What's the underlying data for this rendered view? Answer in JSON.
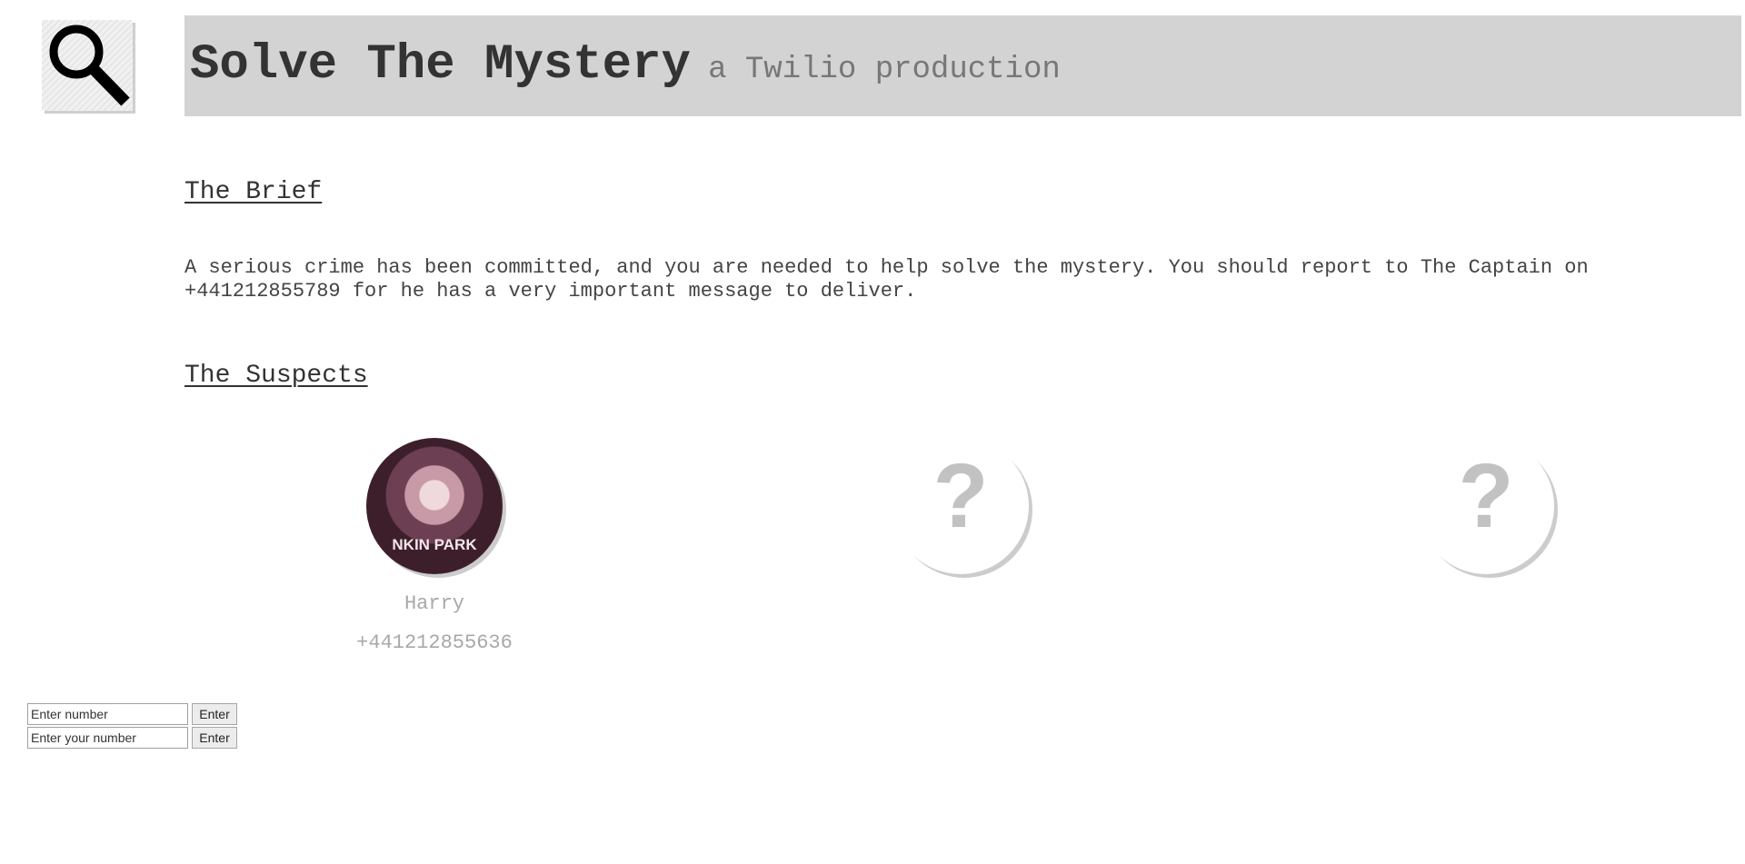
{
  "header": {
    "title": "Solve The Mystery",
    "subtitle": "a Twilio production",
    "logo_icon": "magnifying-glass-icon"
  },
  "brief": {
    "heading": "The Brief",
    "text": "A serious crime has been committed, and you are needed to help solve the mystery. You should report to The Captain on +441212855789 for he has a very important message to deliver."
  },
  "suspects": {
    "heading": "The Suspects",
    "items": [
      {
        "name": "Harry",
        "number": "+441212855636",
        "shirt_text": "NKIN PARK",
        "avatar": "photo"
      },
      {
        "name": "",
        "number": "",
        "avatar": "question-mark-icon",
        "mark": "?"
      },
      {
        "name": "",
        "number": "",
        "avatar": "question-mark-icon",
        "mark": "?"
      }
    ]
  },
  "form": {
    "number_input": {
      "placeholder": "Enter number",
      "value": ""
    },
    "number_button": "Enter",
    "your_number_input": {
      "placeholder": "Enter your number",
      "value": ""
    },
    "your_number_button": "Enter"
  },
  "colors": {
    "header_background": "#d3d3d3",
    "title": "#333333",
    "subtitle": "#777777",
    "suspect_text": "#a8a8a8"
  }
}
